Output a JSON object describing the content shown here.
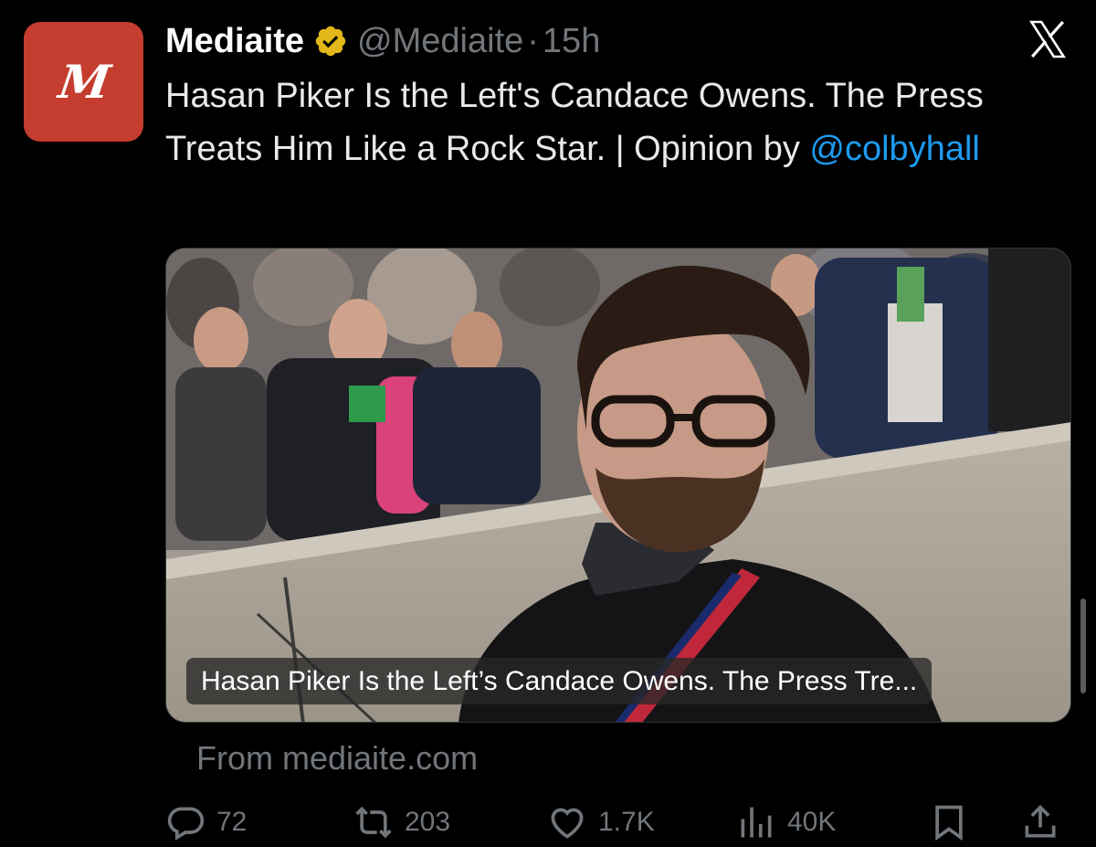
{
  "author": {
    "display_name": "Mediaite",
    "handle": "@Mediaite",
    "separator": "·",
    "time": "15h",
    "avatar_letter": "M",
    "avatar_color": "#c43d2f",
    "verified_color": "#e2b719"
  },
  "tweet": {
    "text": "Hasan Piker Is the Left's Candace Owens. The Press Treats Him Like a Rock Star. | Opinion by ",
    "mention": "@colbyhall"
  },
  "card": {
    "title": "Hasan Piker Is the Left’s Candace Owens. The Press Tre...",
    "source": "From mediaite.com",
    "image_icon": "photo-man-with-glasses-before-crowd"
  },
  "actions": {
    "replies": "72",
    "reposts": "203",
    "likes": "1.7K",
    "views": "40K"
  },
  "colors": {
    "background": "#000000",
    "text": "#e7e9ea",
    "secondary": "#71767b",
    "link": "#1d9bf0"
  }
}
